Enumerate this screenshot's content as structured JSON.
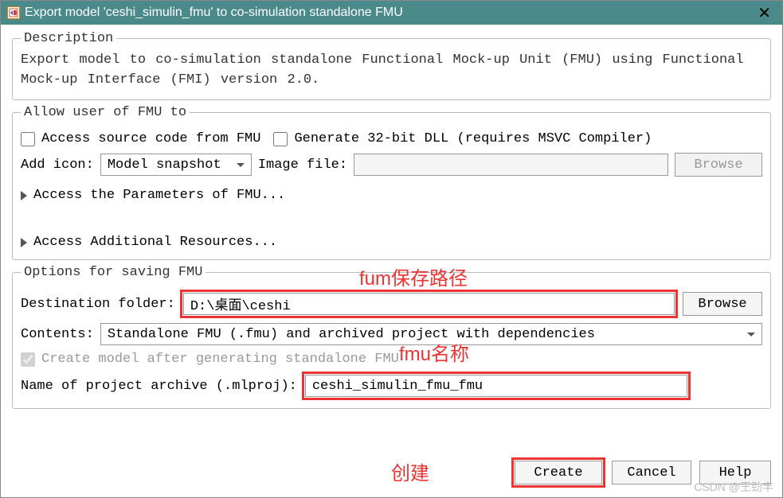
{
  "titlebar": {
    "title": "Export model 'ceshi_simulin_fmu' to co-simulation standalone FMU"
  },
  "description": {
    "legend": "Description",
    "text": "Export model to co-simulation standalone Functional Mock-up Unit (FMU) using Functional Mock-up Interface (FMI) version 2.0."
  },
  "allow": {
    "legend": "Allow user of FMU to",
    "access_source_label": "Access source code from FMU",
    "gen32_label": "Generate 32-bit DLL (requires MSVC Compiler)",
    "add_icon_label": "Add icon:",
    "add_icon_selected": "Model snapshot",
    "image_file_label": "Image file:",
    "image_file_value": "",
    "browse_label": "Browse",
    "access_params_label": "Access the Parameters of FMU...",
    "access_resources_label": "Access Additional Resources..."
  },
  "saving": {
    "legend": "Options for saving FMU",
    "dest_label": "Destination folder:",
    "dest_value": "D:\\桌面\\ceshi",
    "browse_label": "Browse",
    "contents_label": "Contents:",
    "contents_selected": "Standalone FMU (.fmu) and archived project with dependencies",
    "create_model_label": "Create model after generating standalone FMU",
    "proj_name_label": "Name of project archive (.mlproj):",
    "proj_name_value": "ceshi_simulin_fmu_fmu"
  },
  "buttons": {
    "create": "Create",
    "cancel": "Cancel",
    "help": "Help"
  },
  "annotations": {
    "a1": "fum保存路径",
    "a2": "fmu名称",
    "a3": "创建"
  },
  "watermark": "CSDN @王劲丰"
}
